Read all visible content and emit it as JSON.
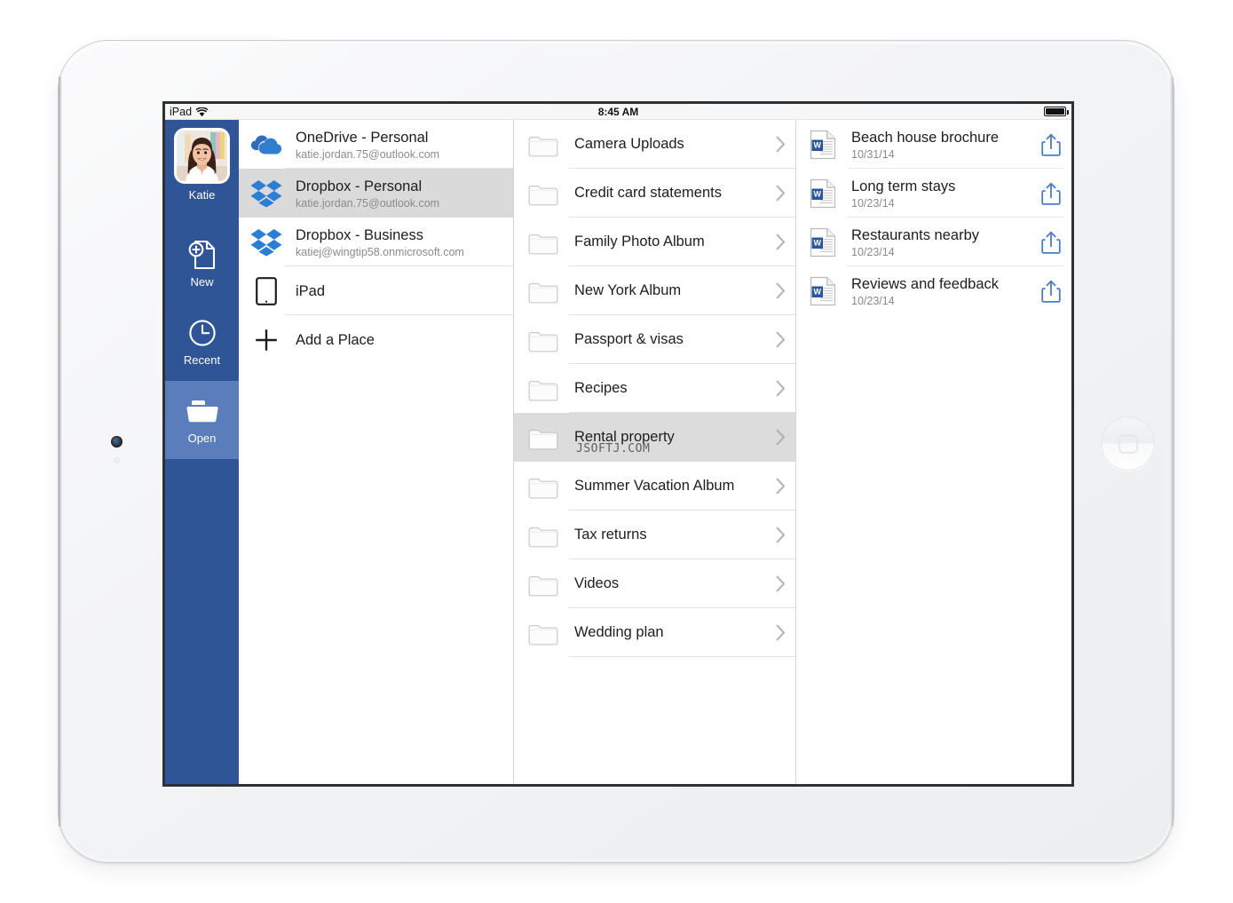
{
  "device": {
    "name": "ipad",
    "home_button": "home-button",
    "camera": "front-camera"
  },
  "status_bar": {
    "carrier": "iPad",
    "wifi_icon": "wifi-icon",
    "time": "8:45 AM",
    "battery_icon": "battery-full-icon"
  },
  "rail": {
    "profile": {
      "name": "Katie",
      "avatar": "user-avatar"
    },
    "items": [
      {
        "label": "New",
        "icon": "new-document-icon",
        "selected": false
      },
      {
        "label": "Recent",
        "icon": "clock-icon",
        "selected": false
      },
      {
        "label": "Open",
        "icon": "folder-icon",
        "selected": true
      }
    ]
  },
  "places": {
    "items": [
      {
        "title": "OneDrive - Personal",
        "subtitle": "katie.jordan.75@outlook.com",
        "icon": "onedrive-icon",
        "selected": false
      },
      {
        "title": "Dropbox - Personal",
        "subtitle": "katie.jordan.75@outlook.com",
        "icon": "dropbox-icon",
        "selected": true
      },
      {
        "title": "Dropbox - Business",
        "subtitle": "katiej@wingtip58.onmicrosoft.com",
        "icon": "dropbox-icon",
        "selected": false
      },
      {
        "title": "iPad",
        "subtitle": "",
        "icon": "ipad-device-icon",
        "selected": false
      },
      {
        "title": "Add a Place",
        "subtitle": "",
        "icon": "plus-icon",
        "selected": false
      }
    ]
  },
  "folders": {
    "chevron_icon": "chevron-right-icon",
    "folder_icon": "folder-outline-icon",
    "watermark": "JSOFTJ.COM",
    "items": [
      {
        "name": "Camera Uploads",
        "selected": false
      },
      {
        "name": "Credit card statements",
        "selected": false
      },
      {
        "name": "Family Photo Album",
        "selected": false
      },
      {
        "name": "New York Album",
        "selected": false
      },
      {
        "name": "Passport & visas",
        "selected": false
      },
      {
        "name": "Recipes",
        "selected": false
      },
      {
        "name": "Rental property",
        "selected": true
      },
      {
        "name": "Summer Vacation Album",
        "selected": false
      },
      {
        "name": "Tax returns",
        "selected": false
      },
      {
        "name": "Videos",
        "selected": false
      },
      {
        "name": "Wedding plan",
        "selected": false
      }
    ]
  },
  "files": {
    "doc_icon": "word-document-icon",
    "share_icon": "share-icon",
    "items": [
      {
        "title": "Beach house brochure",
        "date": "10/31/14"
      },
      {
        "title": "Long term stays",
        "date": "10/23/14"
      },
      {
        "title": "Restaurants nearby",
        "date": "10/23/14"
      },
      {
        "title": "Reviews and feedback",
        "date": "10/23/14"
      }
    ]
  },
  "colors": {
    "rail_blue": "#2f5596",
    "rail_selected": "#5a7dbb",
    "dropbox_blue": "#2a7fd4",
    "onedrive_blue": "#2f6cbd",
    "word_blue": "#2b579a",
    "share_blue": "#4a7ec4",
    "row_selected": "#dcdcdc"
  }
}
